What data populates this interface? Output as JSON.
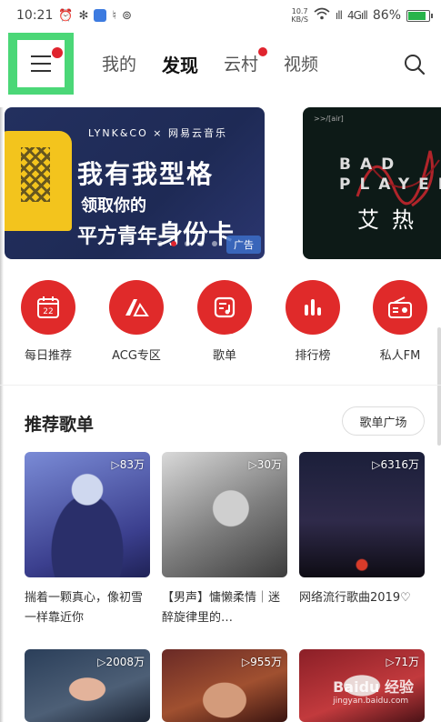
{
  "status_bar": {
    "time": "10:21",
    "net_speed": "10.7",
    "net_unit": "KB/S",
    "signal_1": "ıll",
    "signal_2": "4Gıll",
    "battery_text": "86%",
    "battery_level": 0.86,
    "colors": {
      "battery": "#28b44a"
    }
  },
  "nav": {
    "menu_icon": "hamburger-menu-icon",
    "tabs": [
      {
        "label": "我的",
        "active": false
      },
      {
        "label": "发现",
        "active": true
      },
      {
        "label": "云村",
        "active": false,
        "badge": true
      },
      {
        "label": "视频",
        "active": false
      }
    ],
    "search_icon": "search-icon"
  },
  "banner": {
    "brand": "LYNK&CO × 网易云音乐",
    "headline": "我有我型格",
    "sub1": "领取你的",
    "sub2a": "平方青年",
    "sub2b": "身份卡",
    "ad_label": "广告",
    "page_count": 5,
    "active_page": 1,
    "next": {
      "tag": ">>/[air]",
      "line1": "BAD",
      "line2": "PLAYER",
      "cn": "艾热"
    }
  },
  "categories": [
    {
      "label": "每日推荐",
      "icon": "calendar-icon",
      "icon_text": "22"
    },
    {
      "label": "ACG专区",
      "icon": "acg-icon"
    },
    {
      "label": "歌单",
      "icon": "playlist-icon"
    },
    {
      "label": "排行榜",
      "icon": "chart-bars-icon"
    },
    {
      "label": "私人FM",
      "icon": "radio-icon"
    }
  ],
  "section": {
    "title": "推荐歌单",
    "button": "歌单广场"
  },
  "playlists": [
    {
      "count": "▷83万",
      "title": "揣着一颗真心，像初雪一样靠近你"
    },
    {
      "count": "▷30万",
      "title": "【男声】慵懒柔情｜迷醉旋律里的…"
    },
    {
      "count": "▷6316万",
      "title": "网络流行歌曲2019♡"
    },
    {
      "count": "▷2008万",
      "title": ""
    },
    {
      "count": "▷955万",
      "title": ""
    },
    {
      "count": "▷71万",
      "title": ""
    }
  ],
  "watermark": {
    "line1": "Baidu 经验",
    "line2": "jingyan.baidu.com"
  }
}
